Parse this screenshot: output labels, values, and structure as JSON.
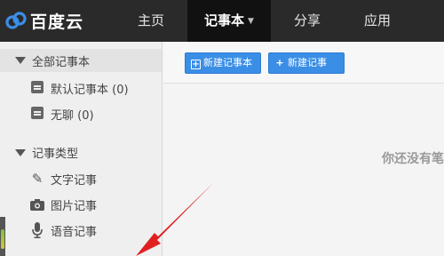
{
  "app": {
    "logo_text": "百度云",
    "logo_icon": "baidu-cloud-icon",
    "logo_color": "#3a8ee6"
  },
  "nav": {
    "items": [
      {
        "label": "主页"
      },
      {
        "label": "记事本",
        "active": true,
        "dropdown_icon": "chevron-down-icon"
      },
      {
        "label": "分享"
      },
      {
        "label": "应用"
      }
    ]
  },
  "sidebar": {
    "notebooks": {
      "header": "全部记事本",
      "items": [
        {
          "label": "默认记事本 (0)",
          "icon": "notebook-icon"
        },
        {
          "label": "无聊 (0)",
          "icon": "notebook-icon"
        }
      ]
    },
    "types": {
      "header": "记事类型",
      "items": [
        {
          "label": "文字记事",
          "icon": "pen-icon"
        },
        {
          "label": "图片记事",
          "icon": "camera-icon"
        },
        {
          "label": "语音记事",
          "icon": "microphone-icon"
        }
      ]
    }
  },
  "toolbar": {
    "new_notebook_label": "新建记事本",
    "new_note_label": "新建记事",
    "accent": "#3a8ee6"
  },
  "main": {
    "empty_message": "你还没有笔"
  },
  "annotation": {
    "arrow_color": "#e02020"
  }
}
